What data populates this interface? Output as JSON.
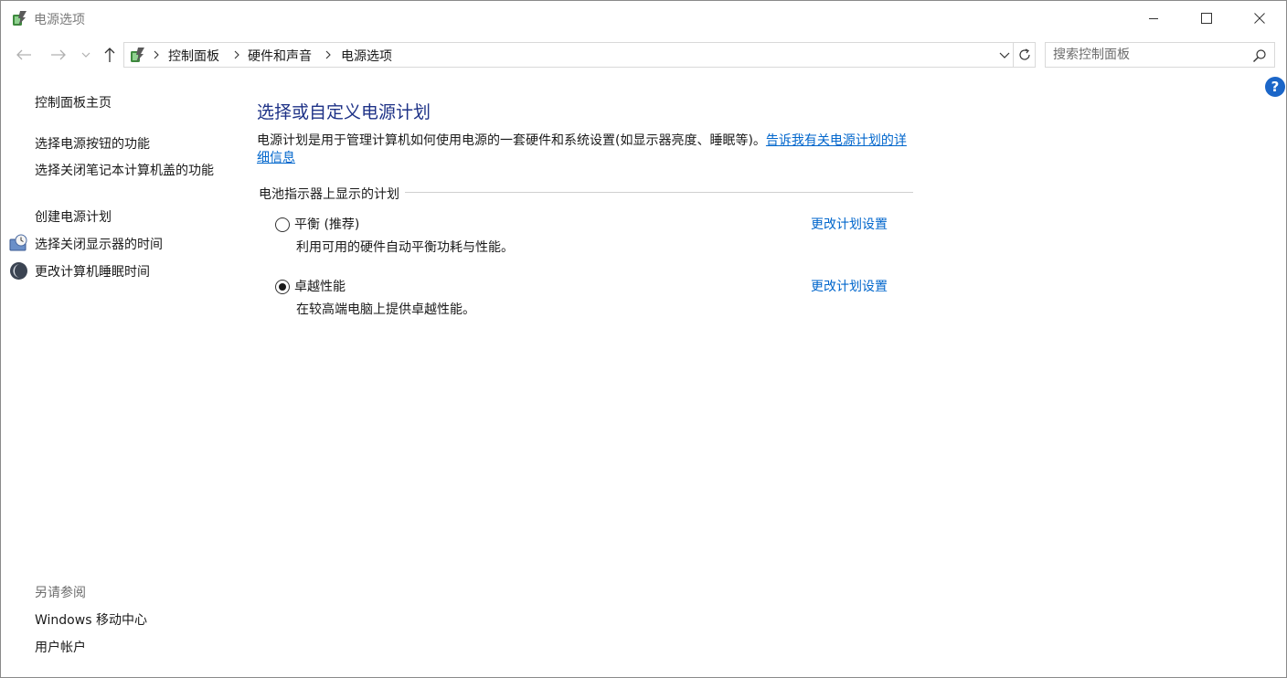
{
  "window": {
    "title": "电源选项"
  },
  "address_bar": {
    "breadcrumbs": [
      "控制面板",
      "硬件和声音",
      "电源选项"
    ]
  },
  "search": {
    "placeholder": "搜索控制面板"
  },
  "sidebar": {
    "items": [
      {
        "label": "控制面板主页",
        "icon": null
      },
      {
        "label": "选择电源按钮的功能",
        "icon": null
      },
      {
        "label": "选择关闭笔记本计算机盖的功能",
        "icon": null
      },
      {
        "label": "创建电源计划",
        "icon": null
      },
      {
        "label": "选择关闭显示器的时间",
        "icon": "display-timer-icon"
      },
      {
        "label": "更改计算机睡眠时间",
        "icon": "sleep-moon-icon"
      }
    ],
    "see_also": {
      "heading": "另请参阅",
      "items": [
        "Windows 移动中心",
        "用户帐户"
      ]
    }
  },
  "main": {
    "title": "选择或自定义电源计划",
    "description": "电源计划是用于管理计算机如何使用电源的一套硬件和系统设置(如显示器亮度、睡眠等)。",
    "description_link": "告诉我有关电源计划的详细信息",
    "group_label": "电池指示器上显示的计划",
    "plans": [
      {
        "name": "平衡 (推荐)",
        "description": "利用可用的硬件自动平衡功耗与性能。",
        "selected": false,
        "link": "更改计划设置"
      },
      {
        "name": "卓越性能",
        "description": "在较高端电脑上提供卓越性能。",
        "selected": true,
        "link": "更改计划设置"
      }
    ]
  },
  "colors": {
    "title_blue": "#1e3287",
    "link_blue": "#0066cc",
    "help_blue": "#1b66c8"
  }
}
